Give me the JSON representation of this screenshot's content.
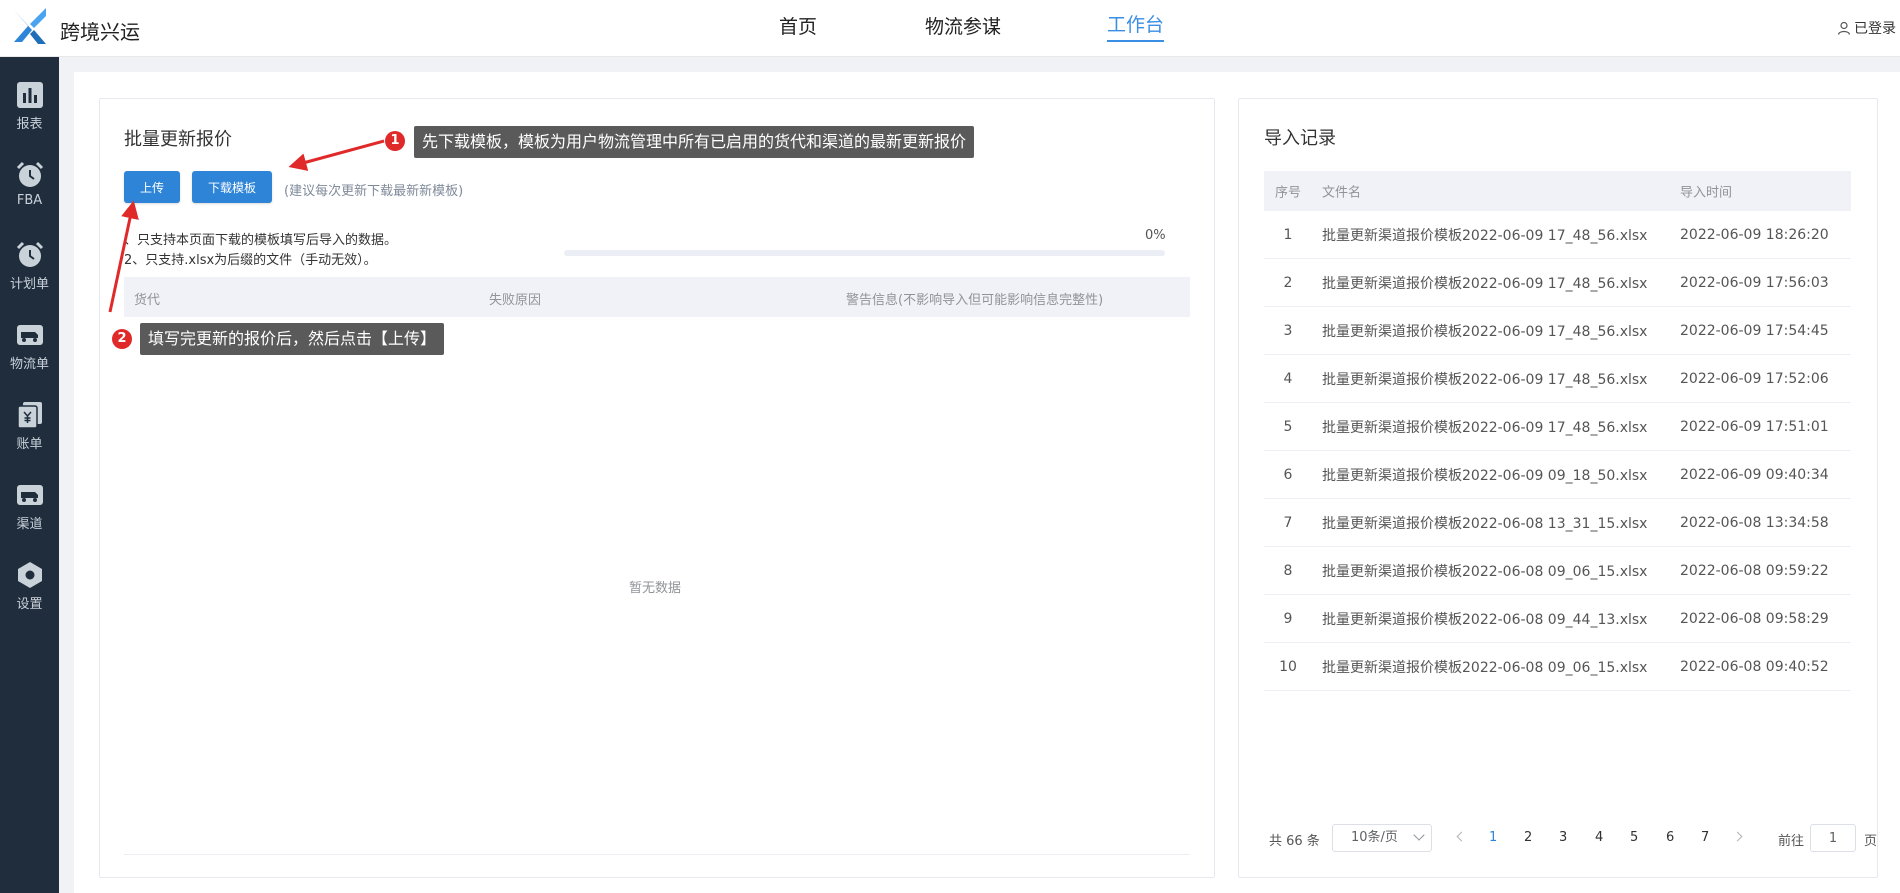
{
  "header": {
    "brand": "跨境兴运",
    "nav": [
      "首页",
      "物流参谋",
      "工作台"
    ],
    "active_nav": "工作台",
    "user_status": "已登录",
    "accent_color": "#3a8ee6"
  },
  "sidebar": {
    "items": [
      {
        "label": "报表",
        "icon": "chart-bar-icon"
      },
      {
        "label": "FBA",
        "icon": "alarm-clock-icon"
      },
      {
        "label": "计划单",
        "icon": "alarm-clock-icon"
      },
      {
        "label": "物流单",
        "icon": "truck-icon"
      },
      {
        "label": "账单",
        "icon": "bill-icon"
      },
      {
        "label": "渠道",
        "icon": "truck-icon"
      },
      {
        "label": "设置",
        "icon": "hexagon-gear-icon"
      }
    ]
  },
  "upload_panel": {
    "title": "批量更新报价",
    "upload_button": "上传",
    "download_button": "下载模板",
    "download_hint": "(建议每次更新下载最新新模板)",
    "notes": [
      "、只支持本页面下载的模板填写后导入的数据。",
      "2、只支持.xlsx为后缀的文件（手动无效）。"
    ],
    "progress_label": "0%",
    "progress_value": 0,
    "columns": [
      "货代",
      "失败原因",
      "警告信息(不影响导入但可能影响信息完整性)"
    ],
    "empty_text": "暂无数据"
  },
  "callouts": [
    {
      "number": "1",
      "text": "先下载模板，模板为用户物流管理中所有已启用的货代和渠道的最新更新报价"
    },
    {
      "number": "2",
      "text": "填写完更新的报价后，然后点击【上传】"
    }
  ],
  "import_records": {
    "title": "导入记录",
    "columns": [
      "序号",
      "文件名",
      "导入时间"
    ],
    "rows": [
      {
        "idx": "1",
        "file": "批量更新渠道报价模板2022-06-09 17_48_56.xlsx",
        "time": "2022-06-09 18:26:20"
      },
      {
        "idx": "2",
        "file": "批量更新渠道报价模板2022-06-09 17_48_56.xlsx",
        "time": "2022-06-09 17:56:03"
      },
      {
        "idx": "3",
        "file": "批量更新渠道报价模板2022-06-09 17_48_56.xlsx",
        "time": "2022-06-09 17:54:45"
      },
      {
        "idx": "4",
        "file": "批量更新渠道报价模板2022-06-09 17_48_56.xlsx",
        "time": "2022-06-09 17:52:06"
      },
      {
        "idx": "5",
        "file": "批量更新渠道报价模板2022-06-09 17_48_56.xlsx",
        "time": "2022-06-09 17:51:01"
      },
      {
        "idx": "6",
        "file": "批量更新渠道报价模板2022-06-09 09_18_50.xlsx",
        "time": "2022-06-09 09:40:34"
      },
      {
        "idx": "7",
        "file": "批量更新渠道报价模板2022-06-08 13_31_15.xlsx",
        "time": "2022-06-08 13:34:58"
      },
      {
        "idx": "8",
        "file": "批量更新渠道报价模板2022-06-08 09_06_15.xlsx",
        "time": "2022-06-08 09:59:22"
      },
      {
        "idx": "9",
        "file": "批量更新渠道报价模板2022-06-08 09_44_13.xlsx",
        "time": "2022-06-08 09:58:29"
      },
      {
        "idx": "10",
        "file": "批量更新渠道报价模板2022-06-08 09_06_15.xlsx",
        "time": "2022-06-08 09:40:52"
      }
    ],
    "pagination": {
      "total": "共 66 条",
      "page_size": "10条/页",
      "pages": [
        "1",
        "2",
        "3",
        "4",
        "5",
        "6",
        "7"
      ],
      "current": "1",
      "goto_label": "前往",
      "goto_value": "1",
      "page_suffix": "页"
    }
  }
}
